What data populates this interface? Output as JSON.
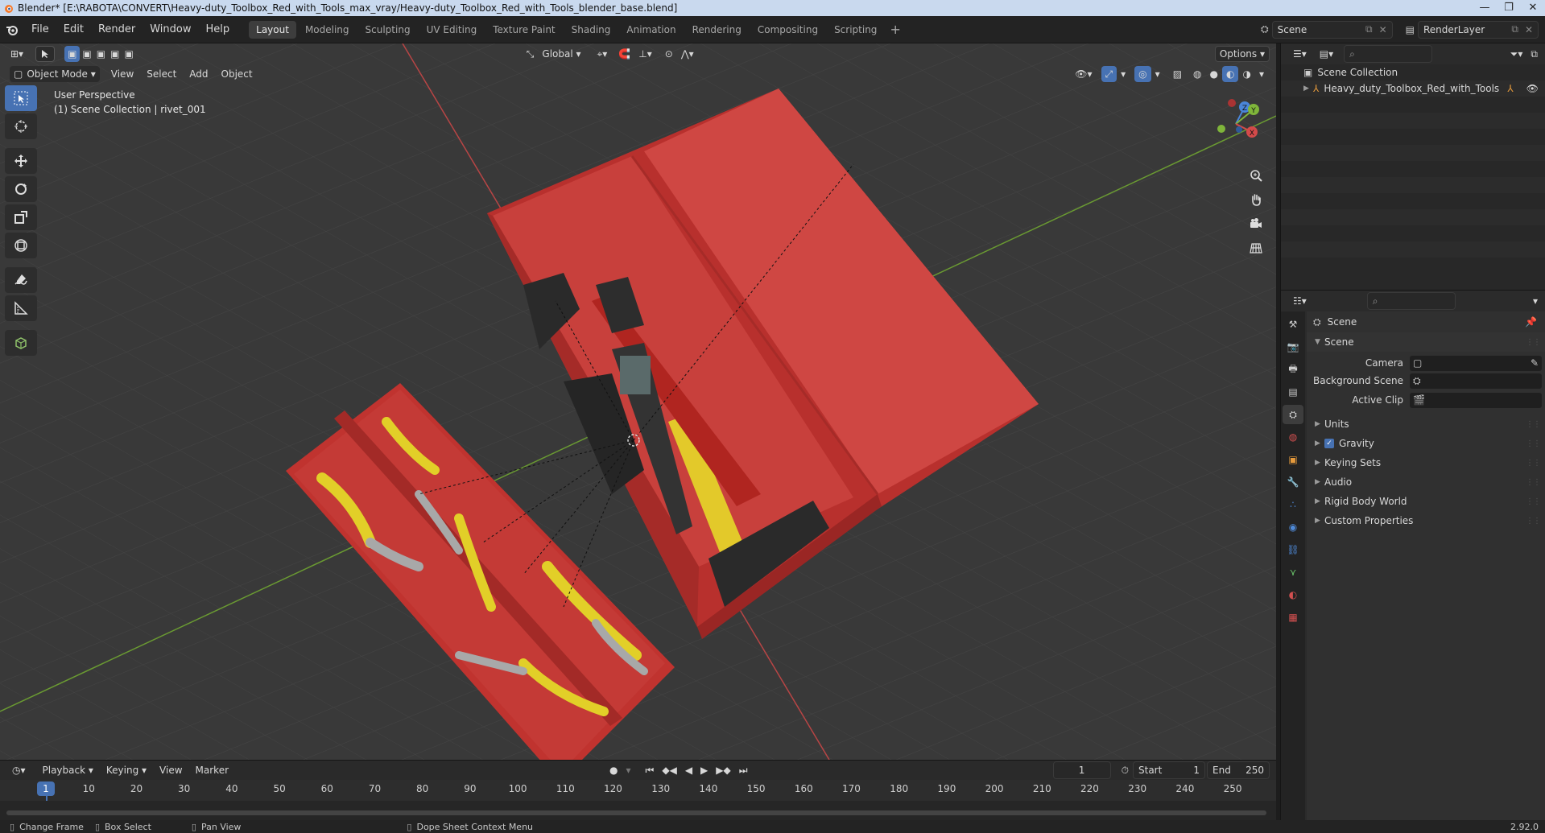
{
  "window": {
    "title": "Blender* [E:\\RABOTA\\CONVERT\\Heavy-duty_Toolbox_Red_with_Tools_max_vray/Heavy-duty_Toolbox_Red_with_Tools_blender_base.blend]",
    "minimize": "—",
    "maximize": "❐",
    "close": "✕"
  },
  "menubar": {
    "items": [
      "File",
      "Edit",
      "Render",
      "Window",
      "Help"
    ]
  },
  "workspaces": {
    "tabs": [
      "Layout",
      "Modeling",
      "Sculpting",
      "UV Editing",
      "Texture Paint",
      "Shading",
      "Animation",
      "Rendering",
      "Compositing",
      "Scripting"
    ],
    "active": "Layout"
  },
  "scene_selector": {
    "value": "Scene"
  },
  "view_layer_selector": {
    "value": "RenderLayer"
  },
  "viewport": {
    "mode": "Object Mode",
    "menus": [
      "View",
      "Select",
      "Add",
      "Object"
    ],
    "transform_orientation": "Global",
    "options_label": "Options",
    "info_line1": "User Perspective",
    "info_line2": "(1) Scene Collection | rivet_001",
    "gizmo_labels": {
      "x": "X",
      "y": "Y",
      "z": "Z"
    }
  },
  "timeline": {
    "menus": [
      "Playback",
      "Keying",
      "View",
      "Marker"
    ],
    "current_frame": "1",
    "start_label": "Start",
    "start_value": "1",
    "end_label": "End",
    "end_value": "250",
    "ticks": [
      "1",
      "10",
      "20",
      "30",
      "40",
      "50",
      "60",
      "70",
      "80",
      "90",
      "100",
      "110",
      "120",
      "130",
      "140",
      "150",
      "160",
      "170",
      "180",
      "190",
      "200",
      "210",
      "220",
      "230",
      "240",
      "250"
    ]
  },
  "statusbar": {
    "items": [
      "Change Frame",
      "Box Select",
      "Pan View",
      "Dope Sheet Context Menu"
    ],
    "version": "2.92.0"
  },
  "outliner": {
    "root": "Scene Collection",
    "items": [
      "Heavy_duty_Toolbox_Red_with_Tools"
    ]
  },
  "properties": {
    "context_title": "Scene",
    "panel_title": "Scene",
    "fields": [
      {
        "label": "Camera",
        "value": ""
      },
      {
        "label": "Background Scene",
        "value": ""
      },
      {
        "label": "Active Clip",
        "value": ""
      }
    ],
    "subpanels": [
      "Units",
      "Gravity",
      "Keying Sets",
      "Audio",
      "Rigid Body World",
      "Custom Properties"
    ],
    "gravity_checked": true
  },
  "colors": {
    "accent": "#4772b3",
    "toolbox_red": "#c83a36",
    "x_axis": "#d34a4a",
    "y_axis": "#7fb53a",
    "z_axis": "#4a86d9"
  }
}
